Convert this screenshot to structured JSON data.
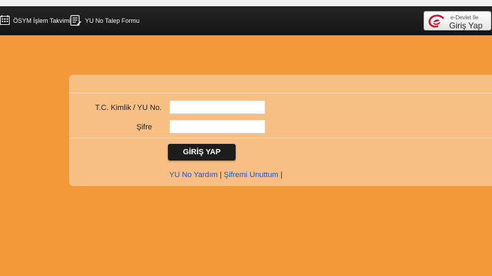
{
  "nav": {
    "calendar_label": "ÖSYM İşlem Takvimi",
    "calendar_icon": "calendar-grid-icon",
    "form_label": "YU No Talep Formu",
    "form_icon": "form-document-icon"
  },
  "edevlet": {
    "small_label": "e-Devlet İle",
    "big_label": "Giriş Yap",
    "logo_icon": "e-devlet-logo-icon",
    "brand_color": "#c8102e"
  },
  "login": {
    "tc_label": "T.C. Kimlik / YU No.",
    "tc_value": "",
    "password_label": "Şifre",
    "password_value": "",
    "submit_label": "GİRİŞ YAP"
  },
  "links": {
    "help_label": "YU No Yardım",
    "forgot_label": "Şifremi Unuttum",
    "separator": "|"
  },
  "colors": {
    "page_background": "#f4993a",
    "panel_background": "#f8bf85",
    "navbar_background": "#1e1e1e",
    "link": "#1d55c7"
  }
}
